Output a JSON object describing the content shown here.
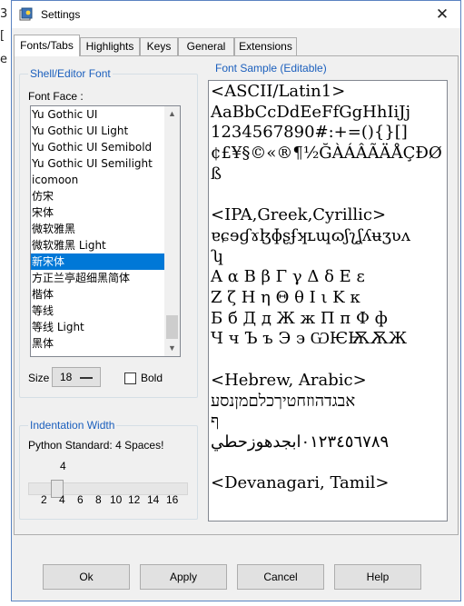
{
  "background": {
    "left_glyphs": [
      "3",
      "[",
      "e"
    ],
    "right_glyph": ","
  },
  "window": {
    "title": "Settings",
    "icon": "python-idle-icon",
    "close_glyph": "✕"
  },
  "tabs": [
    {
      "label": "Fonts/Tabs",
      "active": true
    },
    {
      "label": "Highlights",
      "active": false
    },
    {
      "label": "Keys",
      "active": false
    },
    {
      "label": "General",
      "active": false
    },
    {
      "label": "Extensions",
      "active": false
    }
  ],
  "font_group": {
    "title": "Shell/Editor Font",
    "face_label": "Font Face :",
    "fonts": [
      {
        "name": "Yu Gothic UI",
        "selected": false
      },
      {
        "name": "Yu Gothic UI Light",
        "selected": false
      },
      {
        "name": "Yu Gothic UI Semibold",
        "selected": false
      },
      {
        "name": "Yu Gothic UI Semilight",
        "selected": false
      },
      {
        "name": "icomoon",
        "selected": false
      },
      {
        "name": "仿宋",
        "selected": false
      },
      {
        "name": "宋体",
        "selected": false
      },
      {
        "name": "微软雅黑",
        "selected": false
      },
      {
        "name": "微软雅黑 Light",
        "selected": false
      },
      {
        "name": "新宋体",
        "selected": true
      },
      {
        "name": "方正兰亭超细黑简体",
        "selected": false
      },
      {
        "name": "楷体",
        "selected": false
      },
      {
        "name": "等线",
        "selected": false
      },
      {
        "name": "等线 Light",
        "selected": false
      },
      {
        "name": "黑体",
        "selected": false
      }
    ],
    "size_label": "Size :",
    "size_value": "18",
    "bold_label": "Bold",
    "bold_checked": false
  },
  "indent_group": {
    "title": "Indentation Width",
    "caption": "Python Standard: 4 Spaces!",
    "value": "4",
    "value_fraction": 0.143,
    "ticks": [
      "2",
      "4",
      "6",
      "8",
      "10",
      "12",
      "14",
      "16"
    ]
  },
  "sample": {
    "title": "Font Sample (Editable)",
    "text": "<ASCII/Latin1>\nAaBbCcDdEeFfGgHhIiJj\n1234567890#:+=(){}[]\n¢£¥§©«®¶½ĞÀÁÂÃÄÅÇÐØß\n\n<IPA,Greek,Cyrillic>\nɐɕɘɠɤɮɸʂʄʞʟɰɷʃʅʆʎʉʒʋʌ\nʮ\nΑ α Β β Γ γ Δ δ Ε ε\nΖ ζ Η η Θ θ Ι ι Κ κ\nБ б Д д Ж ж П п Ф ф\nЧ ч Ъ ъ Э э ѠѤѬѪЖ\n\n<Hebrew, Arabic>\nאבגדהוזחטיךכלםמןנסע\nף\n٠١٢٣٤٥٦٧٨٩ابجدهوزحطي\n\n<Devanagari, Tamil>"
  },
  "buttons": {
    "ok": "Ok",
    "apply": "Apply",
    "cancel": "Cancel",
    "help": "Help"
  },
  "colors": {
    "accent": "#1b5fbd",
    "selection": "#0078d7",
    "window_border": "#5a83c1",
    "face": "#f0f0f0"
  }
}
